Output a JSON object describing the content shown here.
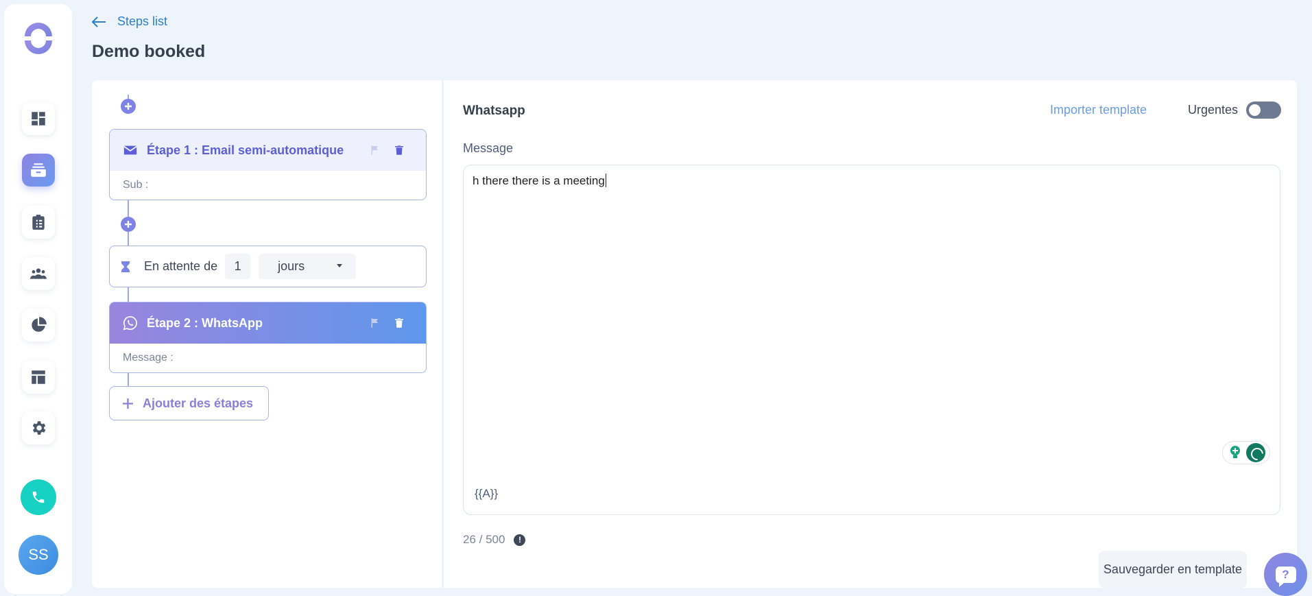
{
  "nav": {
    "back_label": "Steps list",
    "page_title": "Demo booked"
  },
  "sidebar": {
    "items": [
      {
        "name": "dashboard",
        "icon": "dashboard-icon",
        "active": false
      },
      {
        "name": "sequences",
        "icon": "stack-icon",
        "active": true
      },
      {
        "name": "tasks",
        "icon": "clipboard-icon",
        "active": false
      },
      {
        "name": "contacts",
        "icon": "people-icon",
        "active": false
      },
      {
        "name": "reports",
        "icon": "pie-chart-icon",
        "active": false
      },
      {
        "name": "templates",
        "icon": "layout-icon",
        "active": false
      },
      {
        "name": "settings",
        "icon": "gear-icon",
        "active": false
      }
    ],
    "phone_icon": "phone-icon",
    "avatar_initials": "SS"
  },
  "steps": {
    "step1": {
      "title": "Étape 1 : Email semi-automatique",
      "sub": "Sub :",
      "icon": "email-icon"
    },
    "wait": {
      "label": "En attente de",
      "value": "1",
      "unit": "jours"
    },
    "step2": {
      "title": "Étape 2 : WhatsApp",
      "sub": "Message :",
      "icon": "whatsapp-icon"
    },
    "add_label": "Ajouter des étapes"
  },
  "editor": {
    "channel_title": "Whatsapp",
    "import_label": "Importer template",
    "urgent_label": "Urgentes",
    "urgent_on": false,
    "message_label": "Message",
    "message_text": "h there there is a meeting",
    "variable_token": "{{A}}",
    "counter": "26 / 500",
    "save_template_label": "Sauvegarder en template"
  },
  "colors": {
    "accent": "#7e83e6",
    "link": "#2b7fd6",
    "teal": "#17d2c2"
  }
}
